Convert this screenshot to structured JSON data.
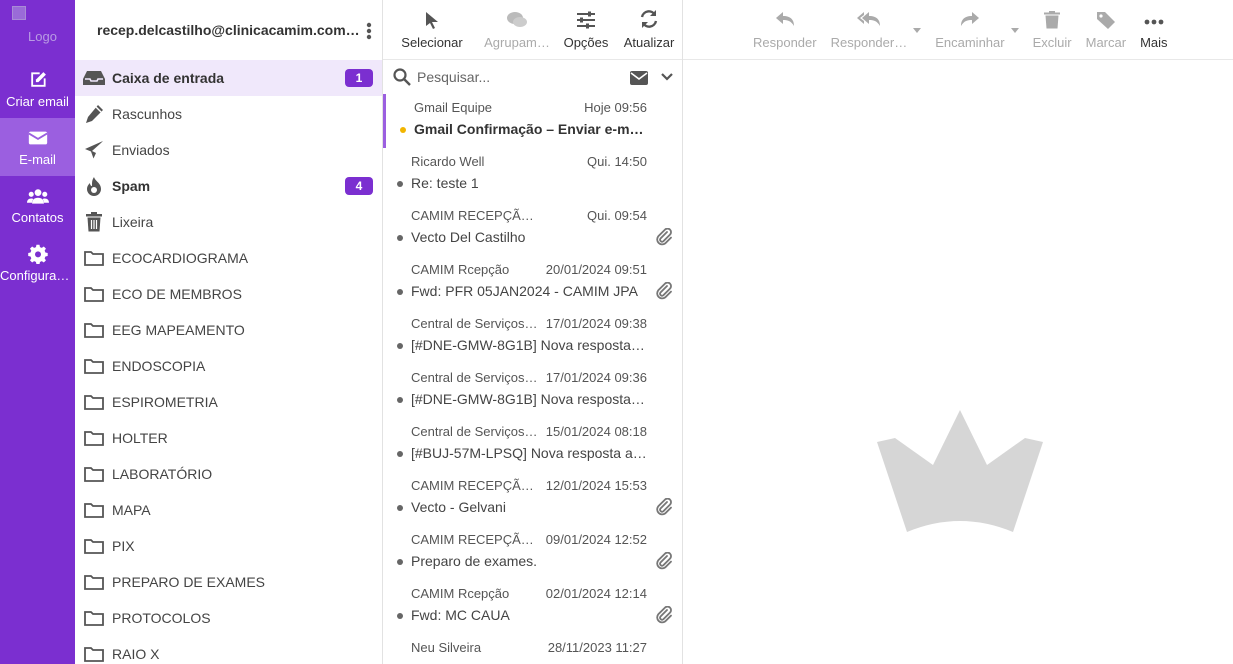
{
  "appnav": {
    "logo_alt": "Logo",
    "items": [
      {
        "label": "Criar email",
        "icon": "compose-icon"
      },
      {
        "label": "E-mail",
        "icon": "envelope-icon"
      },
      {
        "label": "Contatos",
        "icon": "users-icon"
      },
      {
        "label": "Configuraç…",
        "icon": "gear-icon"
      }
    ]
  },
  "account": {
    "email": "recep.delcastilho@clinicacamim.com…"
  },
  "folders": [
    {
      "label": "Caixa de entrada",
      "icon": "inbox-icon",
      "badge": "1"
    },
    {
      "label": "Rascunhos",
      "icon": "pencil-icon"
    },
    {
      "label": "Enviados",
      "icon": "paper-plane-icon"
    },
    {
      "label": "Spam",
      "icon": "fire-icon",
      "badge": "4"
    },
    {
      "label": "Lixeira",
      "icon": "trash-icon"
    },
    {
      "label": "ECOCARDIOGRAMA",
      "icon": "folder-icon"
    },
    {
      "label": "ECO DE MEMBROS",
      "icon": "folder-icon"
    },
    {
      "label": "EEG MAPEAMENTO",
      "icon": "folder-icon"
    },
    {
      "label": "ENDOSCOPIA",
      "icon": "folder-icon"
    },
    {
      "label": "ESPIROMETRIA",
      "icon": "folder-icon"
    },
    {
      "label": "HOLTER",
      "icon": "folder-icon"
    },
    {
      "label": "LABORATÓRIO",
      "icon": "folder-icon"
    },
    {
      "label": "MAPA",
      "icon": "folder-icon"
    },
    {
      "label": "PIX",
      "icon": "folder-icon"
    },
    {
      "label": "PREPARO DE EXAMES",
      "icon": "folder-icon"
    },
    {
      "label": "PROTOCOLOS",
      "icon": "folder-icon"
    },
    {
      "label": "RAIO X",
      "icon": "folder-icon"
    }
  ],
  "listbar": {
    "select": "Selecionar",
    "group": "Agrupam…",
    "options": "Opções",
    "refresh": "Atualizar"
  },
  "search": {
    "placeholder": "Pesquisar..."
  },
  "messages": [
    {
      "from": "Gmail Equipe",
      "date": "Hoje 09:56",
      "subject": "Gmail Confirmação – Enviar e-m…",
      "unread": true,
      "attach": false
    },
    {
      "from": "Ricardo Well",
      "date": "Qui. 14:50",
      "subject": "Re: teste 1",
      "unread": false,
      "attach": false
    },
    {
      "from": "CAMIM RECEPÇÃO CAMP…",
      "date": "Qui. 09:54",
      "subject": "Vecto Del Castilho",
      "unread": false,
      "attach": true
    },
    {
      "from": "CAMIM Rcepção",
      "date": "20/01/2024 09:51",
      "subject": "Fwd: PFR 05JAN2024 - CAMIM JPA",
      "unread": false,
      "attach": true
    },
    {
      "from": "Central de Serviços …",
      "date": "17/01/2024 09:38",
      "subject": "[#DNE-GMW-8G1B] Nova resposta…",
      "unread": false,
      "attach": false
    },
    {
      "from": "Central de Serviços …",
      "date": "17/01/2024 09:36",
      "subject": "[#DNE-GMW-8G1B] Nova resposta…",
      "unread": false,
      "attach": false
    },
    {
      "from": "Central de Serviços …",
      "date": "15/01/2024 08:18",
      "subject": "[#BUJ-57M-LPSQ] Nova resposta a…",
      "unread": false,
      "attach": false
    },
    {
      "from": "CAMIM RECEPÇÃO…",
      "date": "12/01/2024 15:53",
      "subject": "Vecto - Gelvani",
      "unread": false,
      "attach": true
    },
    {
      "from": "CAMIM RECEPÇÃO…",
      "date": "09/01/2024 12:52",
      "subject": "Preparo de exames.",
      "unread": false,
      "attach": true
    },
    {
      "from": "CAMIM Rcepção",
      "date": "02/01/2024 12:14",
      "subject": "Fwd: MC CAUA",
      "unread": false,
      "attach": true
    },
    {
      "from": "Neu Silveira",
      "date": "28/11/2023 11:27",
      "subject": "",
      "unread": false,
      "attach": false
    }
  ],
  "readbar": {
    "reply": "Responder",
    "reply_all": "Responder…",
    "forward": "Encaminhar",
    "delete": "Excluir",
    "mark": "Marcar",
    "more": "Mais"
  },
  "colors": {
    "accent": "#7b2fd0",
    "accent_light": "#9b5fe0",
    "unread_dot": "#f2b500"
  }
}
